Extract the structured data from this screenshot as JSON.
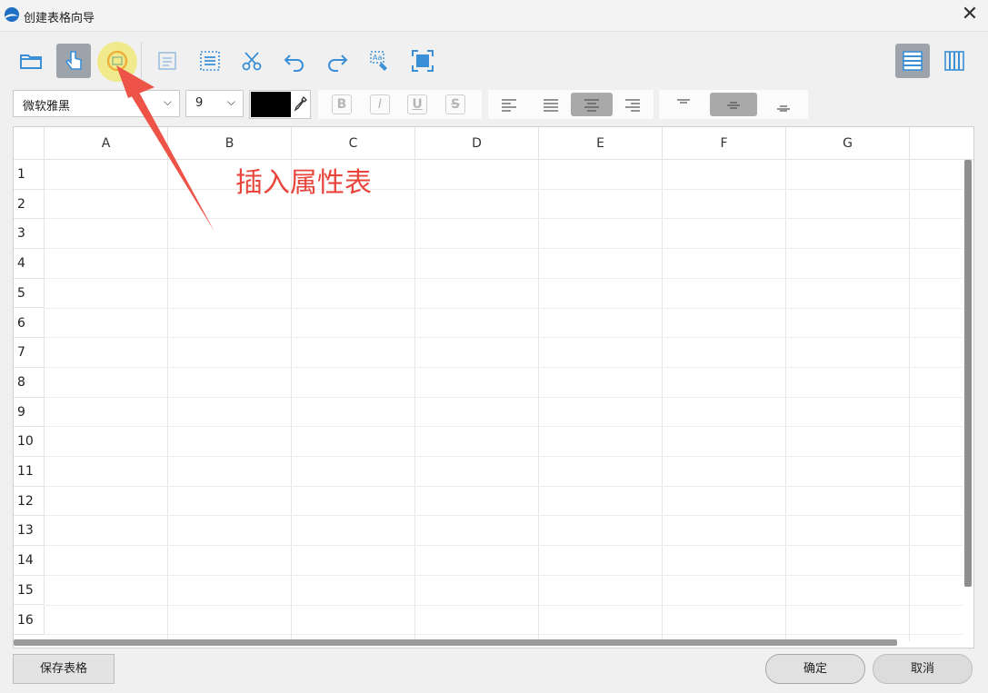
{
  "window": {
    "title": "创建表格向导"
  },
  "toolbar": {
    "buttons": [
      {
        "name": "open-folder",
        "icon": "folder-icon"
      },
      {
        "name": "pointer",
        "icon": "hand-pointer-icon",
        "active": true
      },
      {
        "name": "insert-property-table",
        "icon": "insert-table-icon",
        "highlighted": true
      },
      {
        "name": "text-box",
        "icon": "text-box-icon"
      },
      {
        "name": "select-cells",
        "icon": "select-cells-icon"
      },
      {
        "name": "cut",
        "icon": "scissors-icon"
      },
      {
        "name": "undo",
        "icon": "undo-icon"
      },
      {
        "name": "redo",
        "icon": "redo-icon"
      },
      {
        "name": "format-painter",
        "icon": "format-painter-icon"
      },
      {
        "name": "fit-to-frame",
        "icon": "fit-frame-icon"
      },
      {
        "name": "row-layout",
        "icon": "rows-layout-icon",
        "active": true
      },
      {
        "name": "column-layout",
        "icon": "columns-layout-icon"
      }
    ]
  },
  "format": {
    "font_family": "微软雅黑",
    "font_size": "9",
    "text_color": "#000000",
    "bold_label": "B",
    "italic_label": "I",
    "underline_label": "U",
    "strike_label": "S",
    "h_align_active": "center",
    "v_align_active": "middle"
  },
  "grid": {
    "columns": [
      "A",
      "B",
      "C",
      "D",
      "E",
      "F",
      "G"
    ],
    "rows": [
      "1",
      "2",
      "3",
      "4",
      "5",
      "6",
      "7",
      "8",
      "9",
      "10",
      "11",
      "12",
      "13",
      "14",
      "15",
      "16"
    ]
  },
  "annotation": {
    "text": "插入属性表",
    "color": "#e8453c"
  },
  "footer": {
    "save_label": "保存表格",
    "ok_label": "确定",
    "cancel_label": "取消"
  },
  "colors": {
    "accent_icon": "#3a8fd6",
    "active_bg": "#9da3ab"
  }
}
